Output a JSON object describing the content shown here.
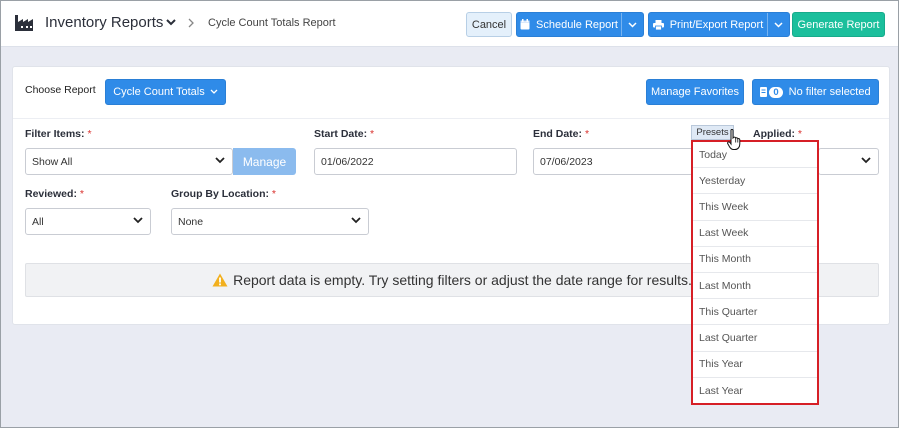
{
  "header": {
    "app_icon": "factory-icon",
    "title": "Inventory Reports",
    "breadcrumb": "Cycle Count Totals Report",
    "buttons": {
      "cancel": "Cancel",
      "schedule": "Schedule Report",
      "print_export": "Print/Export Report",
      "generate": "Generate Report"
    }
  },
  "report": {
    "choose_label": "Choose Report",
    "selected_report": "Cycle Count Totals",
    "manage_favorites": "Manage Favorites",
    "filter_count": "0",
    "filter_status": "No filter selected"
  },
  "filters": {
    "filter_items_label": "Filter Items:",
    "filter_items_value": "Show All",
    "manage_label": "Manage",
    "start_date_label": "Start Date:",
    "start_date_value": "01/06/2022",
    "end_date_label": "End Date:",
    "end_date_value": "07/06/2023",
    "presets_label": "Presets",
    "applied_label": "Applied:",
    "reviewed_label": "Reviewed:",
    "reviewed_value": "All",
    "group_by_label": "Group By Location:",
    "group_by_value": "None",
    "required_mark": "*"
  },
  "alert": {
    "message": "Report data is empty. Try setting filters or adjust the date range for results."
  },
  "presets_menu": {
    "items": [
      "Today",
      "Yesterday",
      "This Week",
      "Last Week",
      "This Month",
      "Last Month",
      "This Quarter",
      "Last Quarter",
      "This Year",
      "Last Year"
    ]
  },
  "colors": {
    "primary": "#2f8be8",
    "success": "#1bbf9c",
    "highlight_border": "#d61f26",
    "required": "#d9302c",
    "warning": "#f2b01e"
  }
}
